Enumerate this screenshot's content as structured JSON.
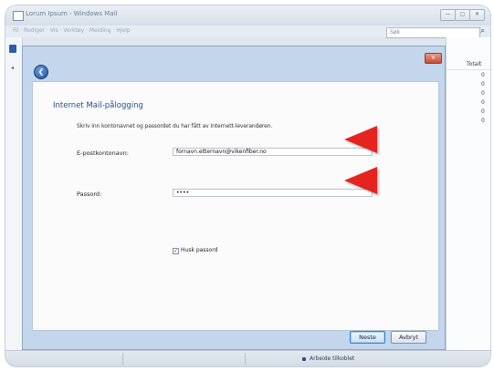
{
  "window": {
    "title": "Lorum Ipsum - Windows Mail",
    "menu": "Fil · Rediger · Vis · Verktøy · Melding · Hjelp",
    "search_placeholder": "Søk",
    "controls": [
      "—",
      "▢",
      "✕"
    ]
  },
  "message_list": {
    "column_header": "Totalt",
    "values": [
      "0",
      "0",
      "0",
      "0",
      "0",
      "0"
    ]
  },
  "statusbar": {
    "text": "Arbeide tilkoblet"
  },
  "dialog": {
    "close_label": "✕",
    "back_label": "❮",
    "heading": "Internet Mail-pålogging",
    "instruction": "Skriv inn kontonavnet og passordet du har fått av Internett-leverandøren.",
    "username_label": "E-postkontonavn:",
    "username_value": "fornavn.etternavn@vikenfiber.no",
    "password_label": "Passord:",
    "password_value": "••••",
    "remember_checked": true,
    "remember_label": "Husk passord",
    "next_button": "Neste",
    "cancel_button": "Avbryt"
  },
  "annotations": {
    "arrow_color": "#e5231f"
  }
}
